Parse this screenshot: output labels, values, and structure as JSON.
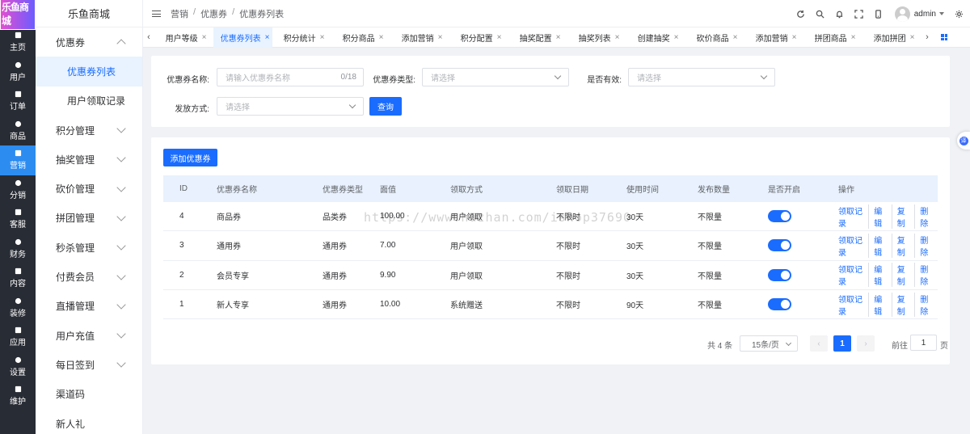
{
  "app": {
    "logo_text": "乐鱼商城",
    "brand": "乐鱼商城"
  },
  "rail": [
    {
      "label": "主页",
      "icon": "home-icon"
    },
    {
      "label": "用户",
      "icon": "user-icon"
    },
    {
      "label": "订单",
      "icon": "order-icon"
    },
    {
      "label": "商品",
      "icon": "goods-icon"
    },
    {
      "label": "营销",
      "icon": "marketing-icon",
      "active": true
    },
    {
      "label": "分销",
      "icon": "send-icon"
    },
    {
      "label": "客服",
      "icon": "bell-icon"
    },
    {
      "label": "财务",
      "icon": "finance-icon"
    },
    {
      "label": "内容",
      "icon": "content-icon"
    },
    {
      "label": "装修",
      "icon": "decor-icon"
    },
    {
      "label": "应用",
      "icon": "apps-icon"
    },
    {
      "label": "设置",
      "icon": "settings-icon"
    },
    {
      "label": "维护",
      "icon": "maintain-icon"
    }
  ],
  "menu": {
    "group_open": "优惠券",
    "sub": [
      "优惠券列表",
      "用户领取记录"
    ],
    "groups": [
      "积分管理",
      "抽奖管理",
      "砍价管理",
      "拼团管理",
      "秒杀管理",
      "付费会员",
      "直播管理",
      "用户充值",
      "每日签到"
    ],
    "plain": [
      "渠道码",
      "新人礼"
    ]
  },
  "header": {
    "breadcrumb": [
      "营销",
      "优惠券",
      "优惠券列表"
    ],
    "username": "admin"
  },
  "tabs": [
    "用户等级",
    "优惠券列表",
    "积分统计",
    "积分商品",
    "添加营销",
    "积分配置",
    "抽奖配置",
    "抽奖列表",
    "创建抽奖",
    "砍价商品",
    "添加营销",
    "拼团商品",
    "添加拼团"
  ],
  "filter": {
    "name_label": "优惠券名称:",
    "name_placeholder": "请输入优惠券名称",
    "name_count": "0/18",
    "type_label": "优惠券类型:",
    "type_placeholder": "请选择",
    "valid_label": "是否有效:",
    "valid_placeholder": "请选择",
    "method_label": "发放方式:",
    "method_placeholder": "请选择",
    "search_btn": "查询"
  },
  "table": {
    "add_btn": "添加优惠券",
    "columns": [
      "ID",
      "优惠券名称",
      "优惠券类型",
      "面值",
      "领取方式",
      "领取日期",
      "使用时间",
      "发布数量",
      "是否开启",
      "操作"
    ],
    "rows": [
      {
        "id": "4",
        "name": "商品券",
        "type": "品类券",
        "value": "100.00",
        "method": "用户领取",
        "date": "不限时",
        "use": "30天",
        "count": "不限量",
        "enabled": true
      },
      {
        "id": "3",
        "name": "通用券",
        "type": "通用券",
        "value": "7.00",
        "method": "用户领取",
        "date": "不限时",
        "use": "30天",
        "count": "不限量",
        "enabled": true
      },
      {
        "id": "2",
        "name": "会员专享",
        "type": "通用券",
        "value": "9.90",
        "method": "用户领取",
        "date": "不限时",
        "use": "30天",
        "count": "不限量",
        "enabled": true
      },
      {
        "id": "1",
        "name": "新人专享",
        "type": "通用券",
        "value": "10.00",
        "method": "系统赠送",
        "date": "不限时",
        "use": "90天",
        "count": "不限量",
        "enabled": true
      }
    ],
    "ops": [
      "领取记录",
      "编辑",
      "复制",
      "删除"
    ]
  },
  "pager": {
    "total": "共 4 条",
    "page_size": "15条/页",
    "current": "1",
    "goto_label": "前往",
    "goto_value": "1",
    "page_unit": "页"
  },
  "watermark": "https://www.huzhan.com/ishop37690",
  "colors": {
    "primary": "#1a6cff",
    "rail_bg": "#282c34",
    "rail_active": "#2d8cf0"
  }
}
